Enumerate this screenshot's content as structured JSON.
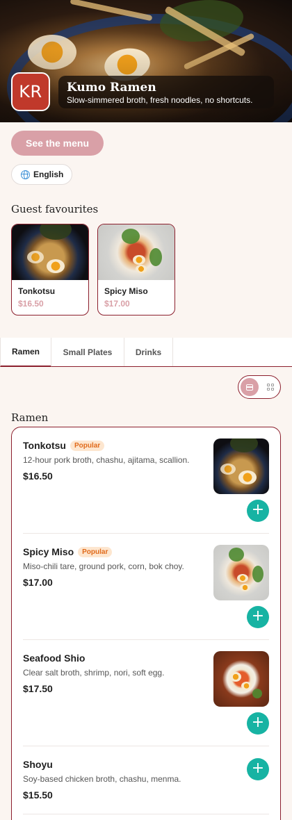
{
  "restaurant": {
    "logo_text": "KR",
    "name": "Kumo Ramen",
    "tagline": "Slow-simmered broth, fresh noodles, no shortcuts."
  },
  "actions": {
    "menu_label": "See the menu",
    "language_label": "English"
  },
  "favourites": {
    "title": "Guest favourites",
    "items": [
      {
        "name": "Tonkotsu",
        "price": "$16.50"
      },
      {
        "name": "Spicy Miso",
        "price": "$17.00"
      }
    ]
  },
  "tabs": [
    "Ramen",
    "Small Plates",
    "Drinks"
  ],
  "active_tab": "Ramen",
  "view_mode": "list",
  "section": {
    "title": "Ramen",
    "items": [
      {
        "name": "Tonkotsu",
        "badge": "Popular",
        "description": "12-hour pork broth, chashu, ajitama, scallion.",
        "price": "$16.50"
      },
      {
        "name": "Spicy Miso",
        "badge": "Popular",
        "description": "Miso-chili tare, ground pork, corn, bok choy.",
        "price": "$17.00"
      },
      {
        "name": "Seafood Shio",
        "description": "Clear salt broth, shrimp, nori, soft egg.",
        "price": "$17.50"
      },
      {
        "name": "Shoyu",
        "description": "Soy-based chicken broth, chashu, menma.",
        "price": "$15.50"
      }
    ]
  },
  "colors": {
    "accent": "#8b1e2c",
    "button_pink": "#d9a0a7",
    "add_teal": "#17b3a3",
    "logo_red": "#c0392b",
    "badge_bg": "#fde6cf",
    "badge_text": "#e06a1b"
  },
  "icons": {
    "language": "globe-icon",
    "add": "plus-icon",
    "list_view": "list-view-icon",
    "grid_view": "grid-view-icon"
  }
}
